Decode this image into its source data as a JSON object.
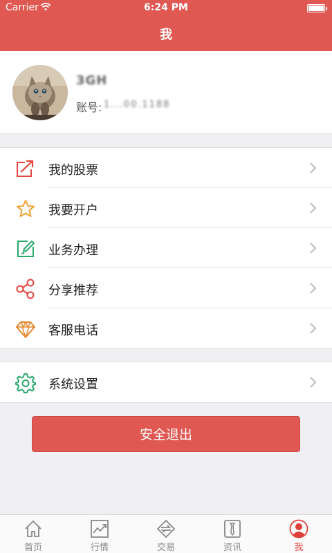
{
  "status_bar": {
    "carrier": "Carrier",
    "time": "6:24 PM"
  },
  "header": {
    "title": "我"
  },
  "profile": {
    "name": "3GH",
    "account_label": "账号:",
    "account_value": "1...00.1188"
  },
  "menu_group1": [
    {
      "label": "我的股票",
      "icon": "trending-up-icon",
      "color": "#e4463f"
    },
    {
      "label": "我要开户",
      "icon": "star-icon",
      "color": "#f0a030"
    },
    {
      "label": "业务办理",
      "icon": "edit-icon",
      "color": "#29a86a"
    },
    {
      "label": "分享推荐",
      "icon": "share-icon",
      "color": "#e4463f"
    },
    {
      "label": "客服电话",
      "icon": "diamond-icon",
      "color": "#e8852a"
    }
  ],
  "menu_group2": [
    {
      "label": "系统设置",
      "icon": "gear-icon",
      "color": "#29a86a"
    }
  ],
  "logout_label": "安全退出",
  "tabs": [
    {
      "label": "首页",
      "icon": "home-icon"
    },
    {
      "label": "行情",
      "icon": "chart-icon"
    },
    {
      "label": "交易",
      "icon": "exchange-icon"
    },
    {
      "label": "资讯",
      "icon": "news-icon"
    },
    {
      "label": "我",
      "icon": "user-icon",
      "active": true
    }
  ],
  "colors": {
    "brand": "#e05852",
    "active_tab": "#e0403a"
  }
}
